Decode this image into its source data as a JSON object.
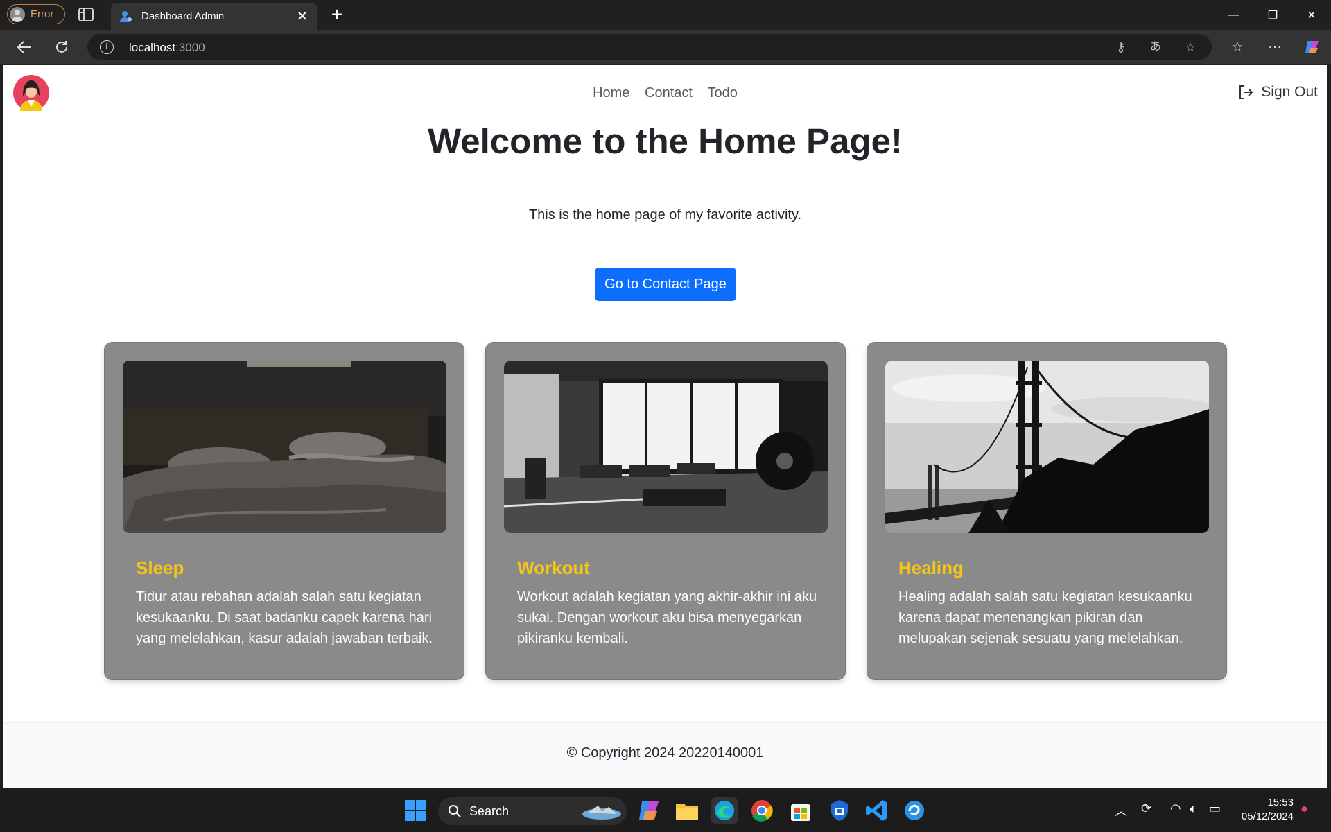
{
  "browser": {
    "profile_label": "Error",
    "tab_title": "Dashboard Admin",
    "url_host": "localhost",
    "url_port": ":3000"
  },
  "nav": {
    "links": [
      "Home",
      "Contact",
      "Todo"
    ],
    "signout_label": "Sign Out"
  },
  "hero": {
    "title": "Welcome to the Home Page!",
    "subtitle": "This is the home page of my favorite activity.",
    "cta_label": "Go to Contact Page"
  },
  "cards": [
    {
      "title": "Sleep",
      "text": "Tidur atau rebahan adalah salah satu kegiatan kesukaanku. Di saat badanku capek karena hari yang melelahkan, kasur adalah jawaban terbaik.",
      "image_icon": "bed-photo"
    },
    {
      "title": "Workout",
      "text": "Workout adalah kegiatan yang akhir-akhir ini aku sukai. Dengan workout aku bisa menyegarkan pikiranku kembali.",
      "image_icon": "gym-photo"
    },
    {
      "title": "Healing",
      "text": "Healing adalah salah satu kegiatan kesukaanku karena dapat menenangkan pikiran dan melupakan sejenak sesuatu yang melelahkan.",
      "image_icon": "bridge-photo"
    }
  ],
  "footer": {
    "text": "© Copyright 2024 20220140001"
  },
  "taskbar": {
    "search_label": "Search",
    "time": "15:53",
    "date": "05/12/2024"
  },
  "colors": {
    "accent_button": "#0d6efd",
    "card_bg": "#8a8a8a",
    "card_title": "#f5c614"
  }
}
